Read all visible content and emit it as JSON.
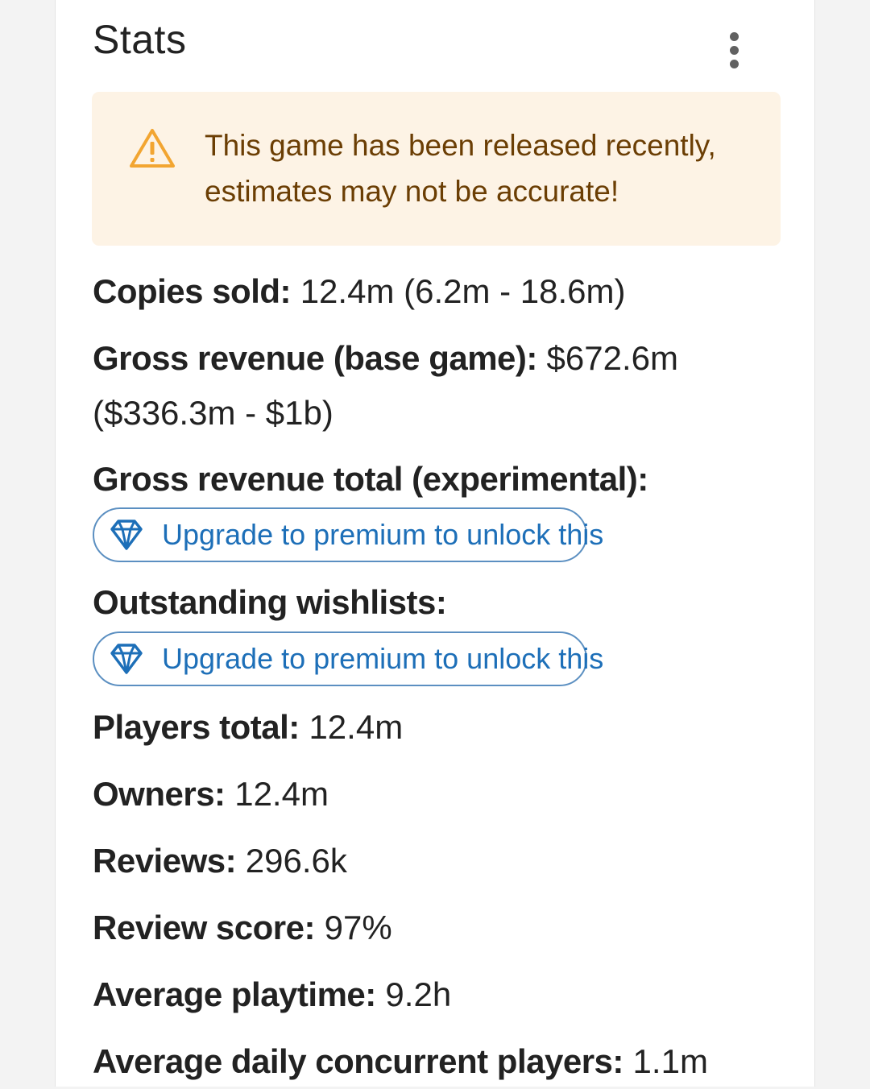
{
  "card": {
    "title": "Stats",
    "menu_icon": "more-vert-icon"
  },
  "alert": {
    "icon": "warning-icon",
    "message": "This game has been released recently, estimates may not be accurate!",
    "background": "#fdf3e5",
    "text_color": "#6b3e04",
    "icon_color": "#f2a531"
  },
  "stats": {
    "copies_sold": {
      "label": "Copies sold:",
      "value": " 12.4m (6.2m - 18.6m)"
    },
    "gross_revenue_base": {
      "label": "Gross revenue (base game):",
      "value": " $672.6m ($336.3m - $1b)"
    },
    "gross_revenue_total": {
      "label": "Gross revenue total (experimental):"
    },
    "outstanding_wishlists": {
      "label": "Outstanding wishlists:"
    },
    "players_total": {
      "label": "Players total:",
      "value": " 12.4m"
    },
    "owners": {
      "label": "Owners:",
      "value": " 12.4m"
    },
    "reviews": {
      "label": "Reviews:",
      "value": " 296.6k"
    },
    "review_score": {
      "label": "Review score:",
      "value": " 97%"
    },
    "average_playtime": {
      "label": "Average playtime:",
      "value": " 9.2h"
    },
    "avg_daily_concurrent": {
      "label": "Average daily concurrent players:",
      "value": " 1.1m"
    }
  },
  "premium": {
    "label": "Upgrade to premium to unlock this",
    "icon": "diamond-icon",
    "accent": "#1d6fb8"
  }
}
